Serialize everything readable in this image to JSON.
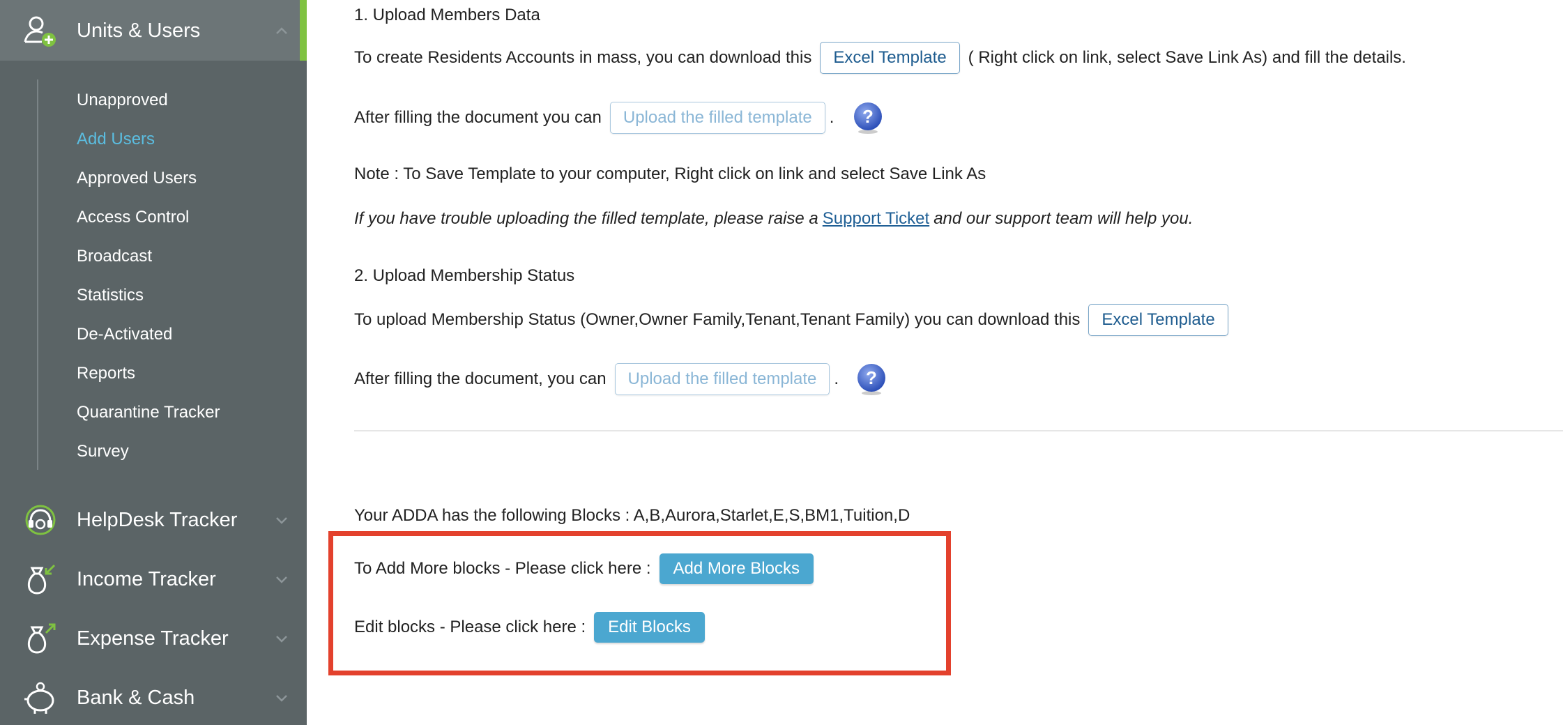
{
  "sidebar": {
    "sections": [
      {
        "label": "Units & Users",
        "icon": "user-add-icon",
        "expanded": true
      },
      {
        "label": "HelpDesk Tracker",
        "icon": "headset-icon",
        "expanded": false
      },
      {
        "label": "Income Tracker",
        "icon": "money-bag-in-icon",
        "expanded": false
      },
      {
        "label": "Expense Tracker",
        "icon": "money-bag-out-icon",
        "expanded": false
      },
      {
        "label": "Bank & Cash",
        "icon": "piggy-bank-icon",
        "expanded": false
      }
    ],
    "sub_items": [
      {
        "label": "Unapproved"
      },
      {
        "label": "Add Users",
        "active": true
      },
      {
        "label": "Approved Users"
      },
      {
        "label": "Access Control"
      },
      {
        "label": "Broadcast"
      },
      {
        "label": "Statistics"
      },
      {
        "label": "De-Activated"
      },
      {
        "label": "Reports"
      },
      {
        "label": "Quarantine Tracker"
      },
      {
        "label": "Survey"
      }
    ],
    "colors": {
      "background": "#5b6466",
      "active_strip": "#7fc241",
      "active_item": "#5bbde0"
    }
  },
  "upload_members": {
    "heading": "1. Upload Members Data",
    "line1_text": "To create Residents Accounts in mass, you can download this",
    "template_button": "Excel Template",
    "line1_suffix": "( Right click on link, select Save Link As) and fill the details.",
    "line2_text": "After filling the document you can",
    "upload_button": "Upload the filled template",
    "line2_suffix": ".",
    "note": "Note : To Save Template to your computer, Right click on link and select Save Link As",
    "trouble_prefix": "If you have trouble uploading the filled template, please raise a",
    "support_link": "Support Ticket",
    "trouble_suffix": "and our support team will help you."
  },
  "upload_membership": {
    "heading": "2. Upload Membership Status",
    "line1_text": "To upload Membership Status (Owner,Owner Family,Tenant,Tenant Family) you can download this",
    "template_button": "Excel Template",
    "line2_text": "After filling the document, you can",
    "upload_button": "Upload the filled template",
    "line2_suffix": "."
  },
  "blocks": {
    "summary": "Your ADDA has the following Blocks : A,B,Aurora,Starlet,E,S,BM1,Tuition,D",
    "add_text": "To Add More blocks - Please click here :",
    "add_button": "Add More Blocks",
    "edit_text": "Edit blocks - Please click here :",
    "edit_button": "Edit Blocks"
  },
  "colors": {
    "primary_button": "#4ba7d0",
    "outline_button_text": "#1e5c8f",
    "highlight_border": "#e3412d",
    "link": "#1f5f95"
  }
}
